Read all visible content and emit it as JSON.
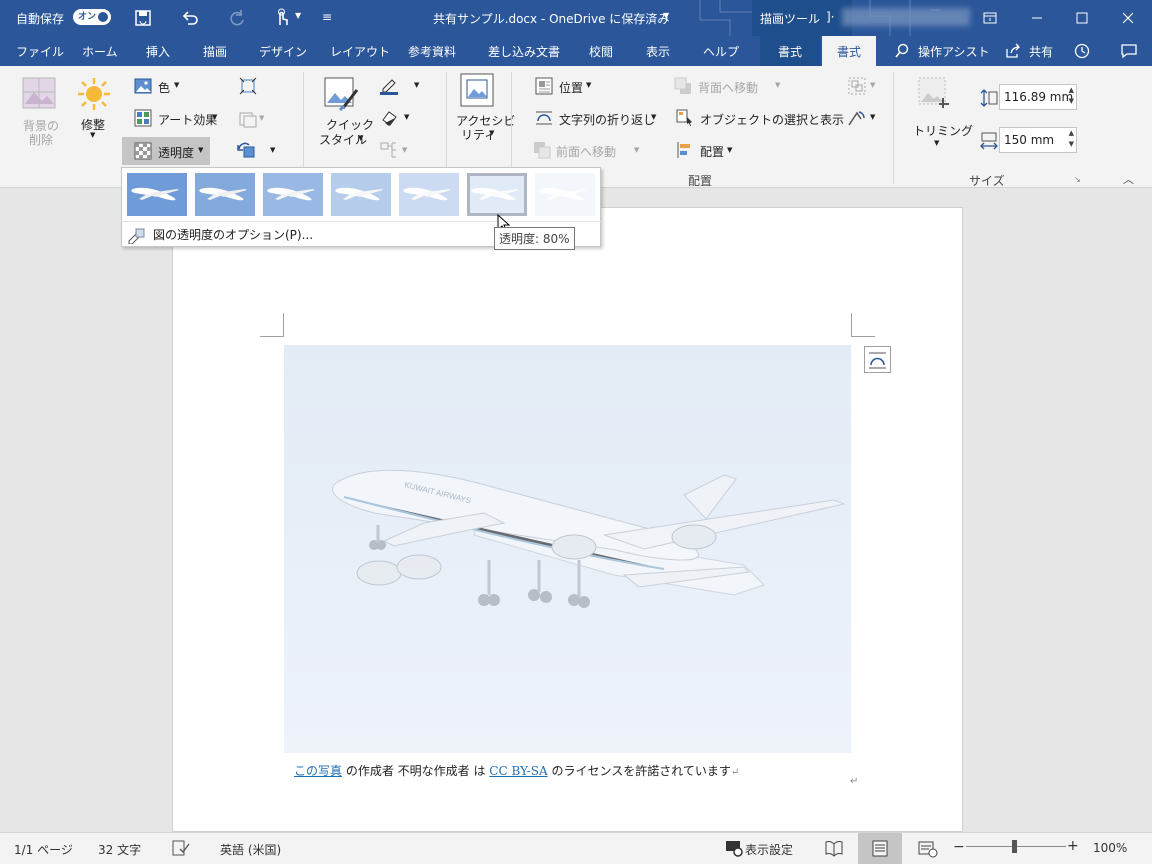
{
  "titlebar": {
    "autosave_label": "自動保存",
    "autosave_toggle": "オン",
    "doc_title": "共有サンプル.docx  -  OneDrive に保存済み",
    "drawing_tools": "描画ツール",
    "context_sep": "]·"
  },
  "tabs": [
    "ファイル",
    "ホーム",
    "挿入",
    "描画",
    "デザイン",
    "レイアウト",
    "参考資料",
    "差し込み文書",
    "校閲",
    "表示",
    "ヘルプ",
    "書式",
    "書式"
  ],
  "tell_me": "操作アシスト",
  "share": "共有",
  "ribbon": {
    "remove_bg": [
      "背景の",
      "削除"
    ],
    "corrections": "修整",
    "color": "色",
    "artistic": "アート効果",
    "transparency": "透明度",
    "quick_styles": [
      "クイック",
      "スタイル"
    ],
    "accessibility": [
      "アクセシビ",
      "リティ"
    ],
    "position": "位置",
    "wrap_text": "文字列の折り返し",
    "bring_forward": "前面へ移動",
    "send_backward": "背面へ移動",
    "selection_pane": "オブジェクトの選択と表示",
    "align": "配置",
    "group_arrange": "配置",
    "crop": "トリミング",
    "height": "116.89 mm",
    "width": "150 mm",
    "group_size": "サイズ"
  },
  "gallery": {
    "option_label": "図の透明度のオプション(P)...",
    "option_key": "P",
    "tooltip": "透明度: 80%",
    "selected_index": 5,
    "levels_opacity": [
      1.0,
      0.85,
      0.7,
      0.5,
      0.35,
      0.2,
      0.08
    ]
  },
  "document": {
    "caption_link1": "この写真",
    "caption_mid1": " の作成者  不明な作成者  は ",
    "caption_link2": "CC BY-SA",
    "caption_end": " のライセンスを許諾されています",
    "return_mark": "↵",
    "aircraft_text": "KUWAIT AIRWAYS"
  },
  "statusbar": {
    "page": "1/1 ページ",
    "words": "32 文字",
    "language": "英語 (米国)",
    "display_settings": "表示設定",
    "zoom": "100%"
  },
  "colors": {
    "brand": "#2b579a",
    "ribbon": "#f3f3f3",
    "sky": "#6f9bd8"
  }
}
